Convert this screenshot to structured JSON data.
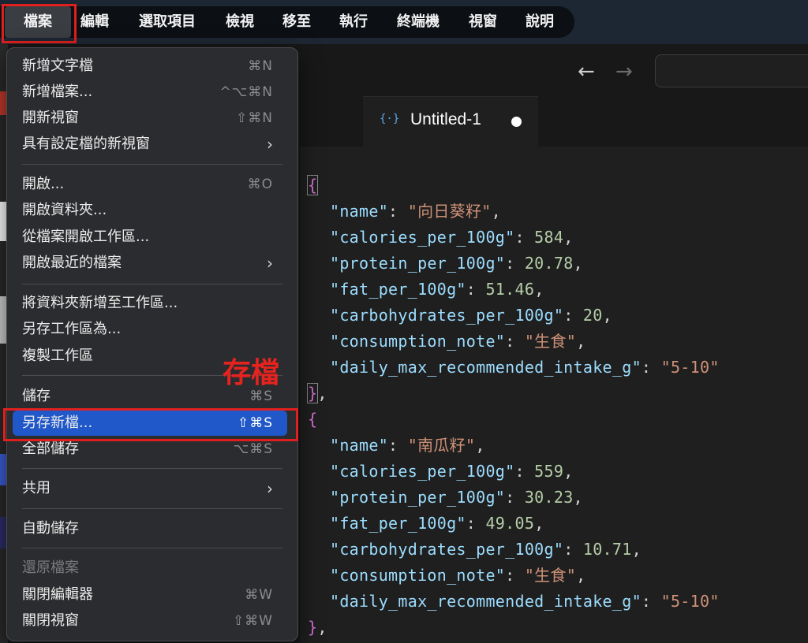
{
  "menubar": {
    "items": [
      "檔案",
      "編輯",
      "選取項目",
      "檢視",
      "移至",
      "執行",
      "終端機",
      "視窗",
      "說明"
    ]
  },
  "nav": {
    "back_icon": "←",
    "forward_icon": "→"
  },
  "tab": {
    "icon": "{·}",
    "title": "Untitled-1"
  },
  "annotation": "存檔",
  "dropdown": {
    "items": [
      {
        "label": "新增文字檔",
        "shortcut": "⌘N"
      },
      {
        "label": "新增檔案...",
        "shortcut": "^⌥⌘N"
      },
      {
        "label": "開新視窗",
        "shortcut": "⇧⌘N"
      },
      {
        "label": "具有設定檔的新視窗",
        "shortcut": "›"
      },
      {
        "label": "開啟...",
        "shortcut": "⌘O"
      },
      {
        "label": "開啟資料夾...",
        "shortcut": ""
      },
      {
        "label": "從檔案開啟工作區...",
        "shortcut": ""
      },
      {
        "label": "開啟最近的檔案",
        "shortcut": "›"
      },
      {
        "label": "將資料夾新增至工作區...",
        "shortcut": ""
      },
      {
        "label": "另存工作區為...",
        "shortcut": ""
      },
      {
        "label": "複製工作區",
        "shortcut": ""
      },
      {
        "label": "儲存",
        "shortcut": "⌘S"
      },
      {
        "label": "另存新檔...",
        "shortcut": "⇧⌘S"
      },
      {
        "label": "全部儲存",
        "shortcut": "⌥⌘S"
      },
      {
        "label": "共用",
        "shortcut": "›"
      },
      {
        "label": "自動儲存",
        "shortcut": ""
      },
      {
        "label": "還原檔案",
        "shortcut": ""
      },
      {
        "label": "關閉編輯器",
        "shortcut": "⌘W"
      },
      {
        "label": "關閉視窗",
        "shortcut": "⇧⌘W"
      }
    ]
  },
  "code": {
    "open_brace": "{",
    "close_brace_comma": "},",
    "comma": ",",
    "objects": [
      {
        "fields": [
          {
            "key": "\"name\"",
            "value": "\"向日葵籽\"",
            "kind": "str"
          },
          {
            "key": "\"calories_per_100g\"",
            "value": "584",
            "kind": "num"
          },
          {
            "key": "\"protein_per_100g\"",
            "value": "20.78",
            "kind": "num"
          },
          {
            "key": "\"fat_per_100g\"",
            "value": "51.46",
            "kind": "num"
          },
          {
            "key": "\"carbohydrates_per_100g\"",
            "value": "20",
            "kind": "num"
          },
          {
            "key": "\"consumption_note\"",
            "value": "\"生食\"",
            "kind": "str"
          },
          {
            "key": "\"daily_max_recommended_intake_g\"",
            "value": "\"5-10\"",
            "kind": "str"
          }
        ]
      },
      {
        "fields": [
          {
            "key": "\"name\"",
            "value": "\"南瓜籽\"",
            "kind": "str"
          },
          {
            "key": "\"calories_per_100g\"",
            "value": "559",
            "kind": "num"
          },
          {
            "key": "\"protein_per_100g\"",
            "value": "30.23",
            "kind": "num"
          },
          {
            "key": "\"fat_per_100g\"",
            "value": "49.05",
            "kind": "num"
          },
          {
            "key": "\"carbohydrates_per_100g\"",
            "value": "10.71",
            "kind": "num"
          },
          {
            "key": "\"consumption_note\"",
            "value": "\"生食\"",
            "kind": "str"
          },
          {
            "key": "\"daily_max_recommended_intake_g\"",
            "value": "\"5-10\"",
            "kind": "str"
          }
        ]
      }
    ]
  }
}
